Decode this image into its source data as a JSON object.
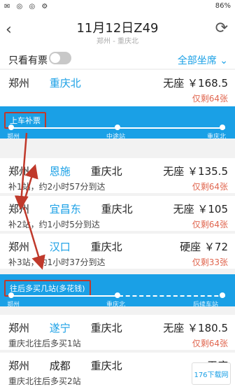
{
  "status": {
    "left_icons": "✉ ◎ ◎ ⚙",
    "right": "86%"
  },
  "header": {
    "title": "11月12日Z49",
    "subtitle": "郑州 - 重庆北"
  },
  "filter": {
    "only_tickets_label": "只看有票",
    "seat_filter": "全部坐席 ⌄"
  },
  "rows": [
    {
      "from": "郑州",
      "mid": "",
      "to": "重庆北",
      "seat": "无座 ￥168.5",
      "remain": "仅剩64张",
      "desc": ""
    },
    {
      "from": "郑州",
      "mid": "恩施",
      "to": "重庆北",
      "seat": "无座 ￥135.5",
      "remain": "仅剩64张",
      "desc": "补1站，约2小时57分到达"
    },
    {
      "from": "郑州",
      "mid": "宜昌东",
      "to": "重庆北",
      "seat": "无座 ￥105",
      "remain": "仅剩64张",
      "desc": "补2站，约1小时5分到达"
    },
    {
      "from": "郑州",
      "mid": "汉口",
      "to": "重庆北",
      "seat": "硬座 ￥72",
      "remain": "仅剩33张",
      "desc": "补3站，约1小时37分到达"
    },
    {
      "from": "郑州",
      "mid": "遂宁",
      "to": "重庆北",
      "seat": "无座 ￥180.5",
      "remain": "仅剩64张",
      "desc": "重庆北往后多买1站"
    },
    {
      "from": "郑州",
      "mid": "成都",
      "to": "重庆北",
      "seat": "无座",
      "remain": "",
      "desc": "重庆北往后多买2站"
    }
  ],
  "route1": {
    "tag": "上车补票",
    "points": [
      "郑州",
      "中途站",
      "重庆北"
    ]
  },
  "route2": {
    "tag": "往后多买几站(多花钱)",
    "points": [
      "郑州",
      "重庆北",
      "后续车站"
    ]
  },
  "watermark": "176下载网"
}
